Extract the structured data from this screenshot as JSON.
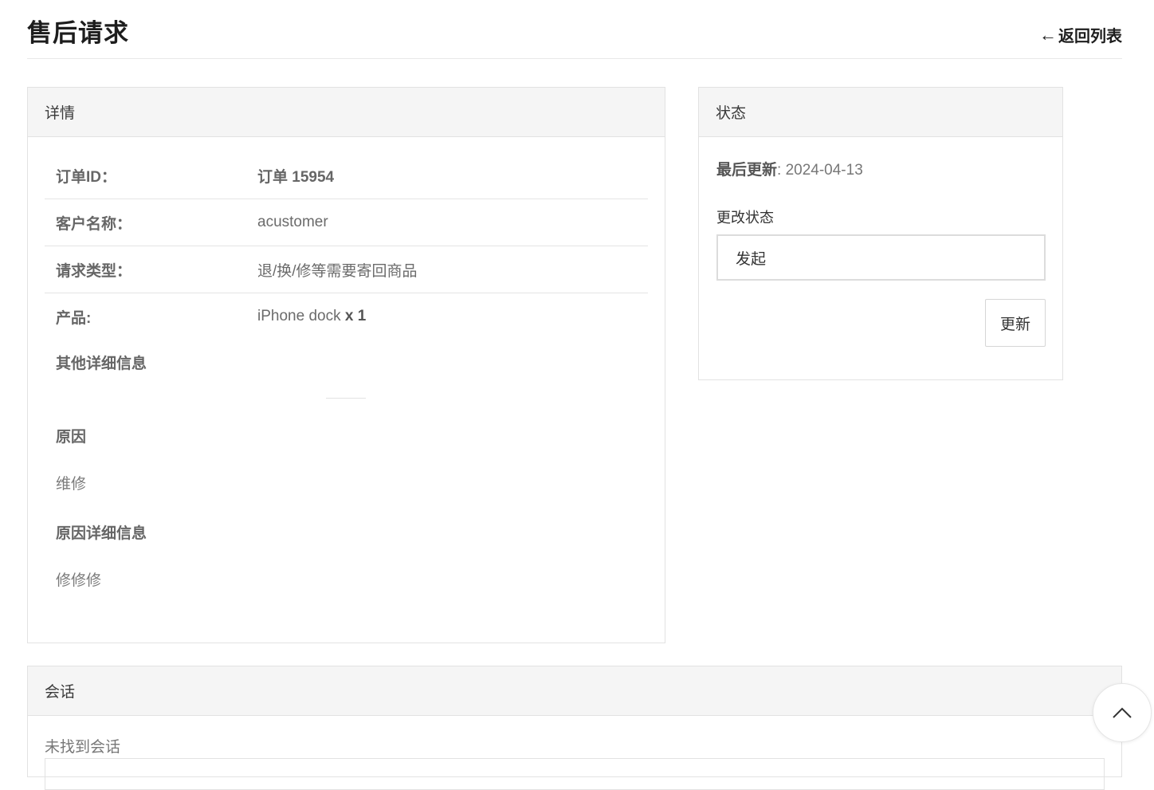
{
  "header": {
    "title": "售后请求",
    "back_arrow": "←",
    "back_label": "返回列表"
  },
  "details": {
    "heading": "详情",
    "rows": [
      {
        "label": "订单ID：",
        "value": "订单 15954"
      },
      {
        "label": "客户名称：",
        "value": "acustomer"
      },
      {
        "label": "请求类型：",
        "value": "退/换/修等需要寄回商品"
      },
      {
        "label": "产品:",
        "value": "iPhone dock",
        "qty": "x 1"
      }
    ],
    "other_info_title": "其他详细信息",
    "reason_title": "原因",
    "reason_value": "维修",
    "reason_detail_title": "原因详细信息",
    "reason_detail_value": "修修修"
  },
  "status": {
    "heading": "状态",
    "last_update_label": "最后更新",
    "last_update_value": ": 2024-04-13",
    "change_label": "更改状态",
    "selected": "发起",
    "update_button": "更新"
  },
  "conversation": {
    "heading": "会话",
    "empty_text": "未找到会话"
  },
  "icons": {
    "scroll_top": "chevron-up-icon"
  }
}
